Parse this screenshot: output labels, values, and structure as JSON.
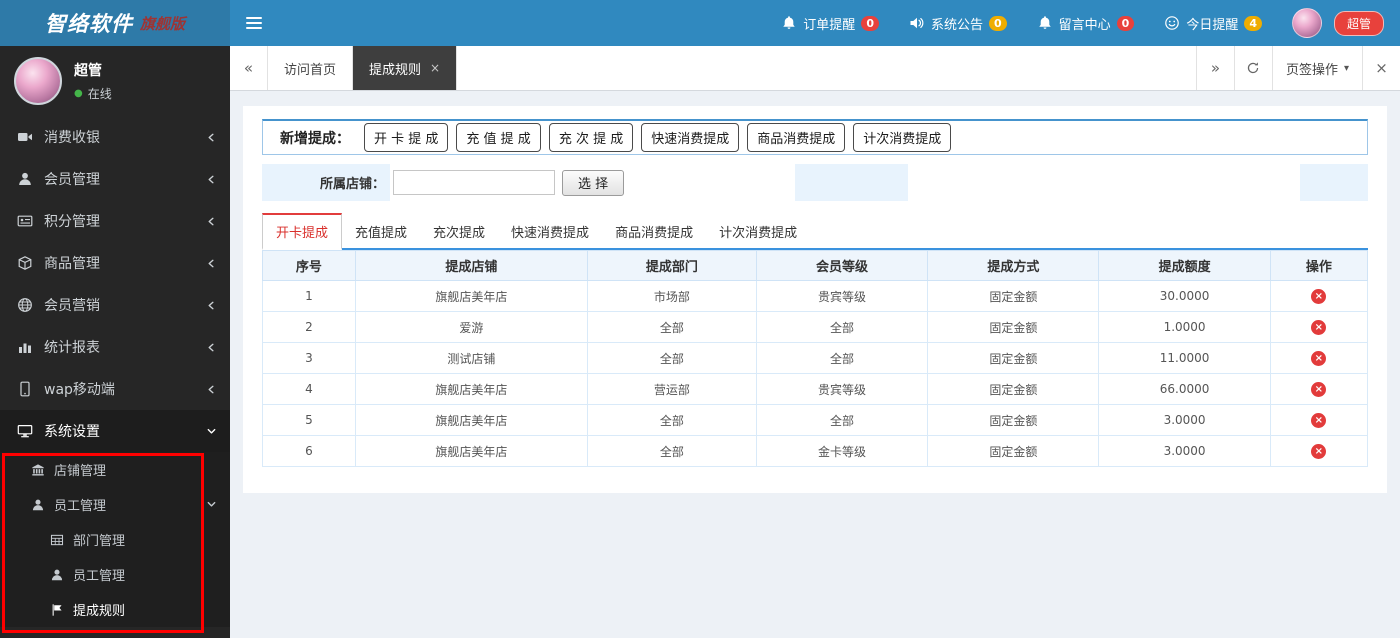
{
  "glyphs": {
    "nav_left": "«",
    "nav_right": "»",
    "caret_down": "▾",
    "close": "×",
    "delete": "×",
    "online_dot": "●"
  },
  "colors": {
    "header_bg": "#3089bf",
    "logo_bg": "#2e7aa8",
    "sidebar_bg": "#262626",
    "accent_blue": "#3a92de",
    "active_tab_red": "#d9302c",
    "badge_red": "#e8413c",
    "badge_yellow": "#efad00",
    "annotation_red": "#ff0000"
  },
  "header": {
    "brand": "智络软件",
    "edition": "旗舰版",
    "notifications": [
      {
        "icon": "bell-icon",
        "label": "订单提醒",
        "count": "0",
        "badge": "red"
      },
      {
        "icon": "speaker-icon",
        "label": "系统公告",
        "count": "0",
        "badge": "yellow"
      },
      {
        "icon": "bell-icon",
        "label": "留言中心",
        "count": "0",
        "badge": "red"
      },
      {
        "icon": "smiley-chat-icon",
        "label": "今日提醒",
        "count": "4",
        "badge": "yellow"
      }
    ],
    "role_badge": "超管"
  },
  "sidebar": {
    "user": {
      "name": "超管",
      "status": "在线"
    },
    "menu": [
      {
        "icon": "video-icon",
        "label": "消费收银"
      },
      {
        "icon": "user-icon",
        "label": "会员管理"
      },
      {
        "icon": "idcard-icon",
        "label": "积分管理"
      },
      {
        "icon": "goods-icon",
        "label": "商品管理"
      },
      {
        "icon": "globe-icon",
        "label": "会员营销"
      },
      {
        "icon": "chart-icon",
        "label": "统计报表"
      },
      {
        "icon": "mobile-icon",
        "label": "wap移动端"
      },
      {
        "icon": "desktop-icon",
        "label": "系统设置"
      }
    ],
    "submenu": [
      {
        "icon": "shop-icon",
        "label": "店铺管理"
      },
      {
        "icon": "staff-icon",
        "label": "员工管理"
      },
      {
        "icon": "department-icon",
        "label": "部门管理"
      },
      {
        "icon": "staff-icon",
        "label": "员工管理"
      },
      {
        "icon": "flag-icon",
        "label": "提成规则"
      }
    ]
  },
  "tabbar": {
    "tabs": [
      {
        "label": "访问首页",
        "active": false
      },
      {
        "label": "提成规则",
        "active": true
      }
    ],
    "dropdown": "页签操作"
  },
  "content": {
    "add": {
      "label": "新增提成：",
      "buttons": [
        "开 卡 提 成",
        "充 值 提 成",
        "充 次 提 成",
        "快速消费提成",
        "商品消费提成",
        "计次消费提成"
      ]
    },
    "filter": {
      "label": "所属店铺：",
      "value": "",
      "button": "选 择"
    },
    "tabs": [
      "开卡提成",
      "充值提成",
      "充次提成",
      "快速消费提成",
      "商品消费提成",
      "计次消费提成"
    ],
    "active_tab": "开卡提成",
    "table": {
      "headers": [
        "序号",
        "提成店铺",
        "提成部门",
        "会员等级",
        "提成方式",
        "提成额度",
        "操作"
      ],
      "rows": [
        [
          "1",
          "旗舰店美年店",
          "市场部",
          "贵宾等级",
          "固定金额",
          "30.0000"
        ],
        [
          "2",
          "爱游",
          "全部",
          "全部",
          "固定金额",
          "1.0000"
        ],
        [
          "3",
          "测试店铺",
          "全部",
          "全部",
          "固定金额",
          "11.0000"
        ],
        [
          "4",
          "旗舰店美年店",
          "营运部",
          "贵宾等级",
          "固定金额",
          "66.0000"
        ],
        [
          "5",
          "旗舰店美年店",
          "全部",
          "全部",
          "固定金额",
          "3.0000"
        ],
        [
          "6",
          "旗舰店美年店",
          "全部",
          "金卡等级",
          "固定金额",
          "3.0000"
        ]
      ]
    }
  }
}
